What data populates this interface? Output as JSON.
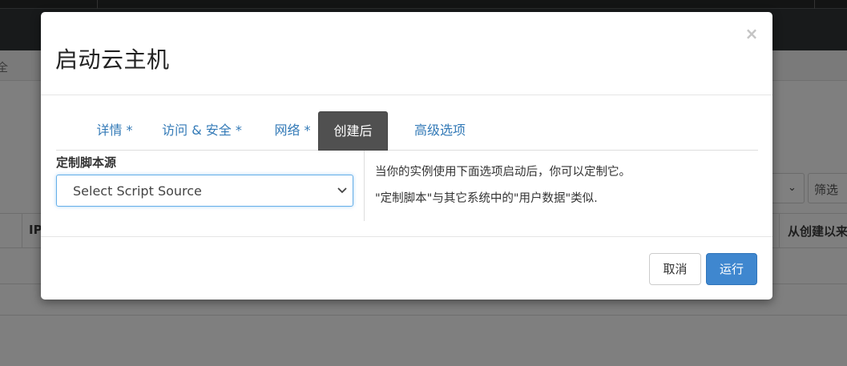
{
  "background": {
    "crumb_fragment": "全",
    "filter_button": "筛选",
    "table_headers": {
      "ip": "IP",
      "created": "从创建以来"
    }
  },
  "modal": {
    "title": "启动云主机",
    "close_glyph": "×",
    "tabs": [
      {
        "label": "详情 *",
        "active": false
      },
      {
        "label": "访问 & 安全 *",
        "active": false
      },
      {
        "label": "网络 *",
        "active": false
      },
      {
        "label": "创建后",
        "active": true
      },
      {
        "label": "高级选项",
        "active": false
      }
    ],
    "script_source": {
      "label": "定制脚本源",
      "selected": "Select Script Source"
    },
    "help": {
      "line1": "当你的实例使用下面选项启动后，你可以定制它。",
      "line2": "\"定制脚本\"与其它系统中的\"用户数据\"类似."
    },
    "footer": {
      "cancel_label": "取消",
      "run_label": "运行"
    }
  },
  "colors": {
    "primary": "#3f87cf",
    "link": "#337ab7",
    "active_tab": "#505050",
    "overlay": "#7f7f7f"
  }
}
